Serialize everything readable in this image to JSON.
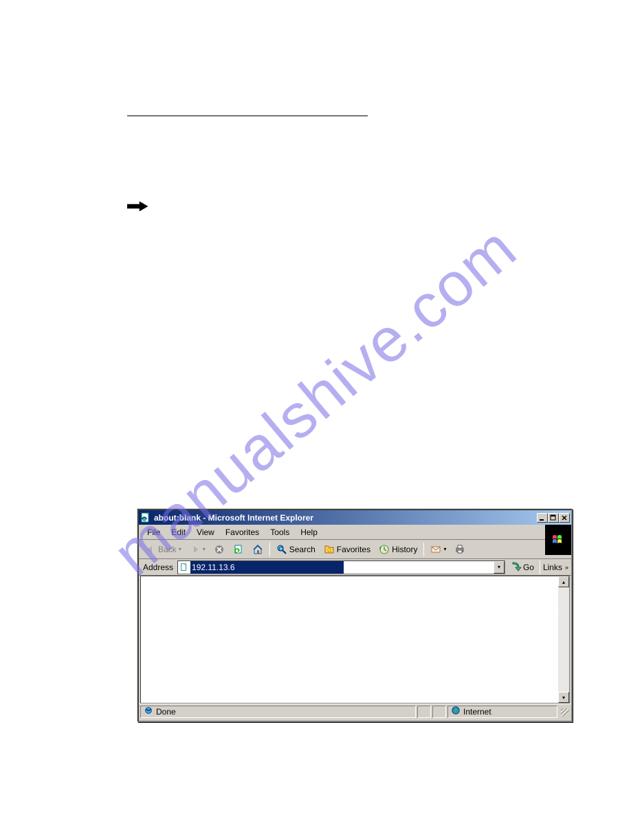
{
  "watermark": "manualshive.com",
  "ie": {
    "title": "about:blank - Microsoft Internet Explorer",
    "menus": {
      "file": "File",
      "edit": "Edit",
      "view": "View",
      "favorites": "Favorites",
      "tools": "Tools",
      "help": "Help"
    },
    "toolbar": {
      "back": "Back",
      "search": "Search",
      "favorites": "Favorites",
      "history": "History"
    },
    "address": {
      "label": "Address",
      "value": "192.11.13.6",
      "go": "Go",
      "links": "Links"
    },
    "status": {
      "done": "Done",
      "zone": "Internet"
    }
  }
}
